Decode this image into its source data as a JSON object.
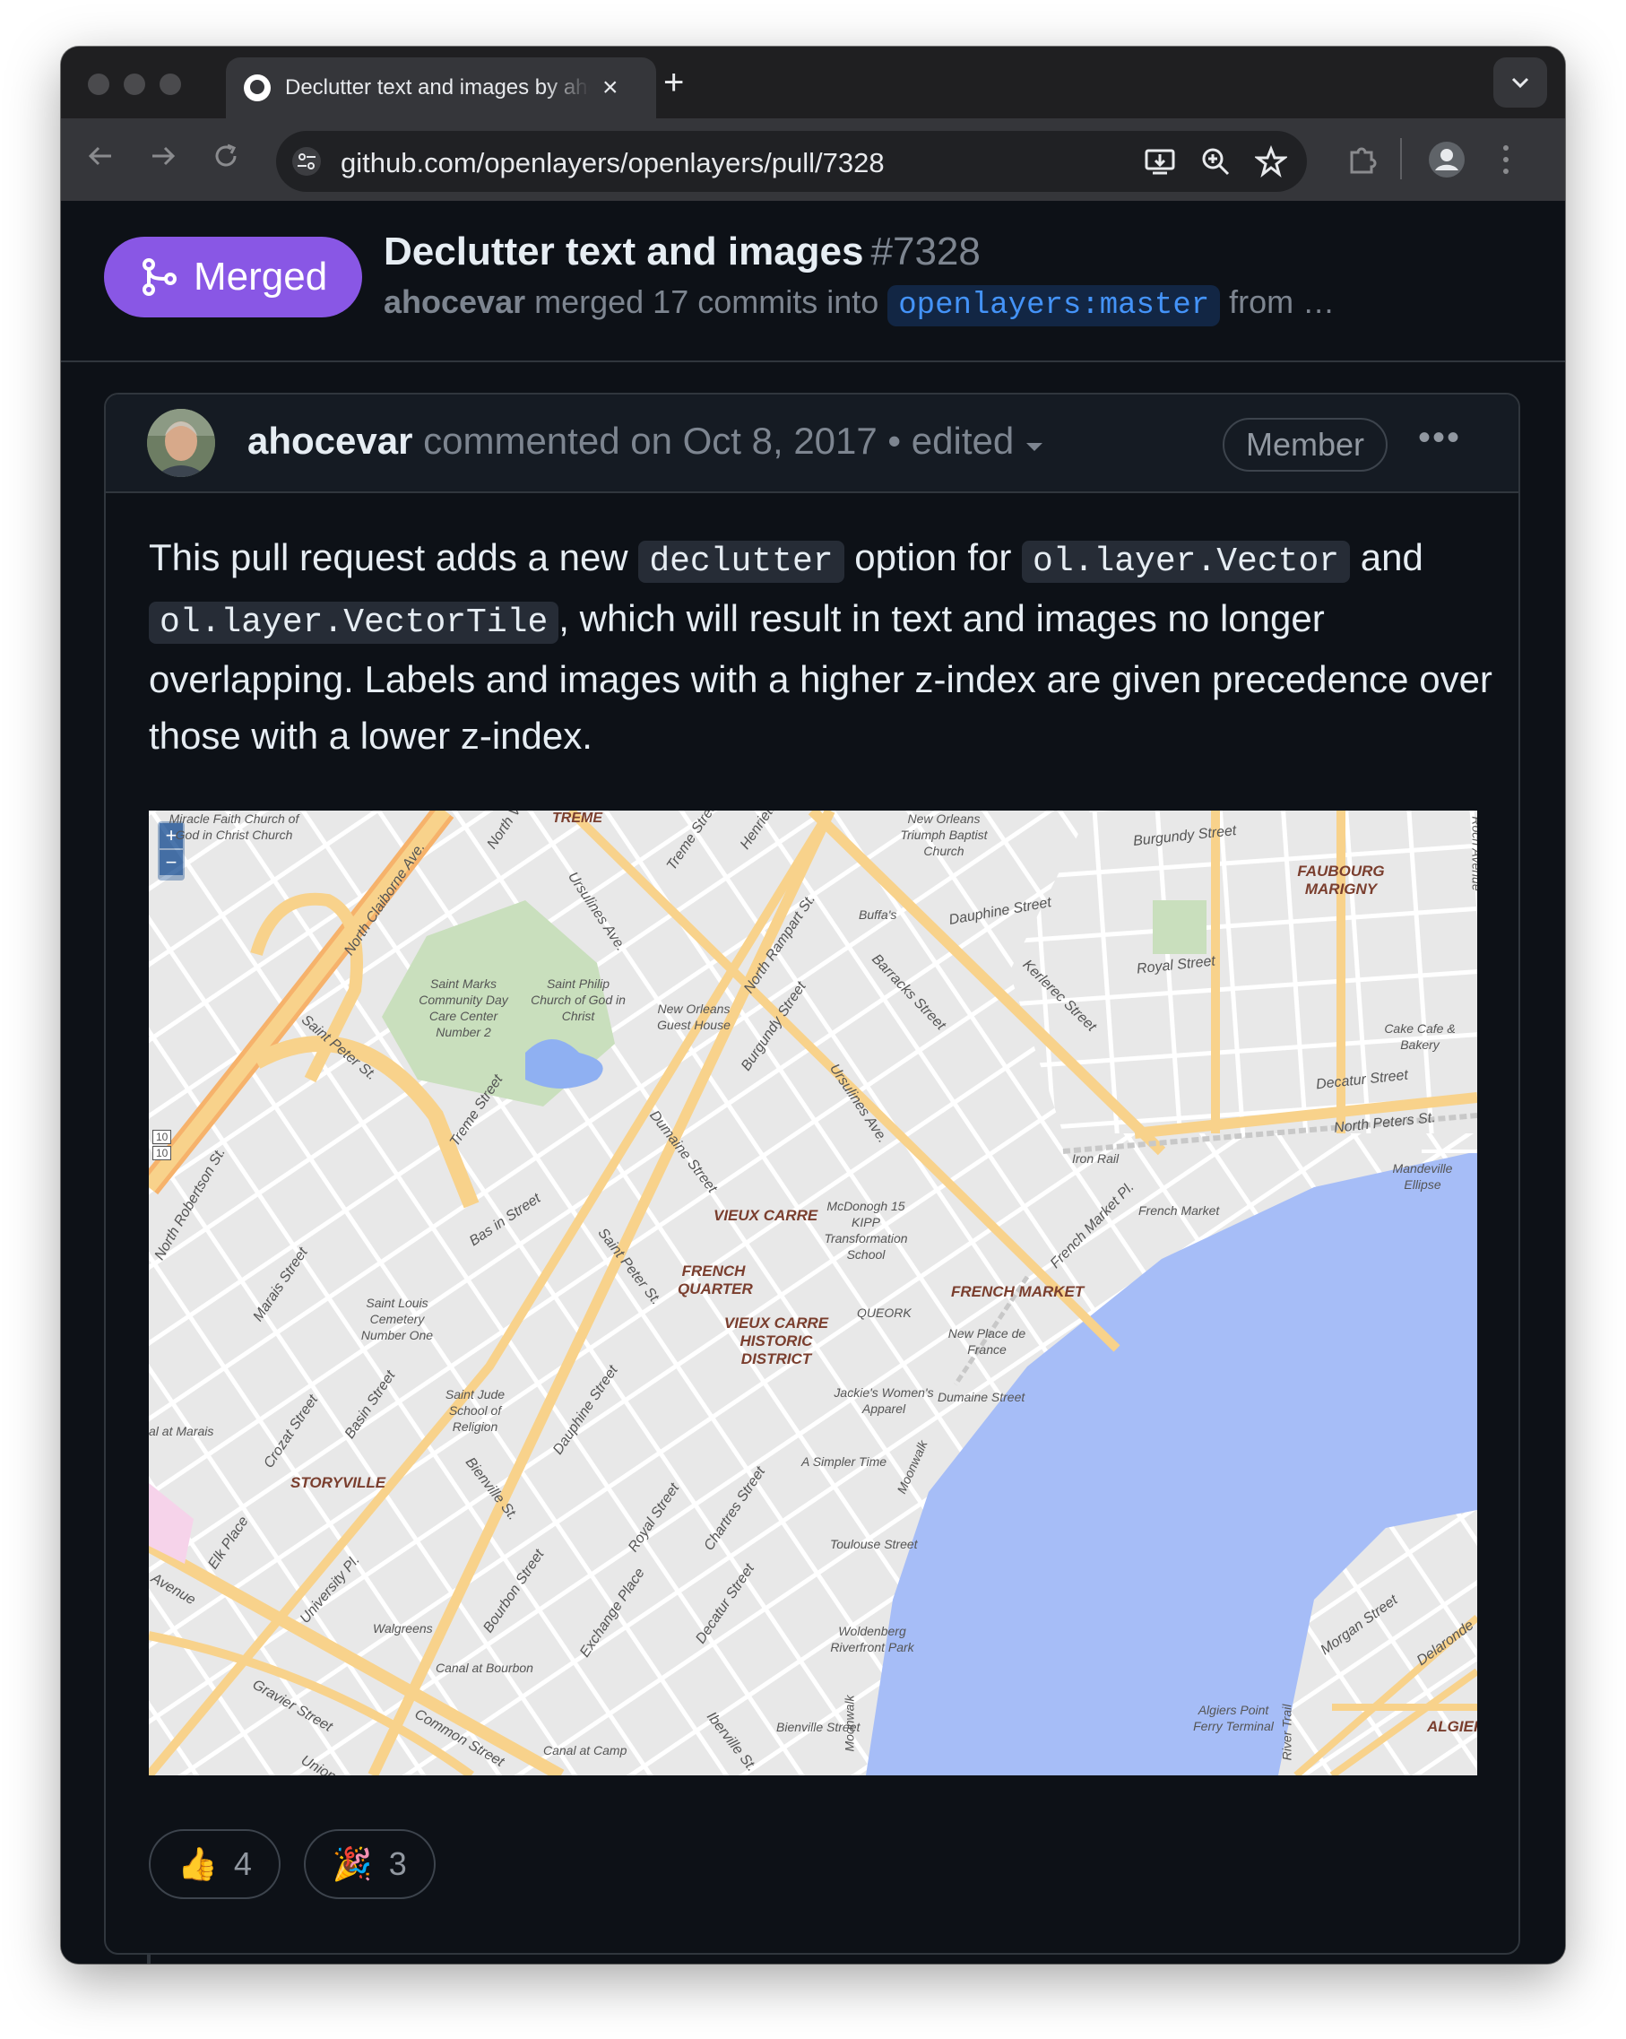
{
  "browser": {
    "tab_title": "Declutter text and images by ahocevar",
    "tab_close": "×",
    "new_tab": "+",
    "url": "github.com/openlayers/openlayers/pull/7328"
  },
  "pr": {
    "status": "Merged",
    "title": "Declutter text and images",
    "number": "#7328",
    "author": "ahocevar",
    "merge_text": " merged 17 commits into ",
    "base_branch": "openlayers:master",
    "from_text": " from …"
  },
  "comment": {
    "author": "ahocevar",
    "action": " commented on Oct 8, 2017 • edited ",
    "role": "Member",
    "more": "•••",
    "body": {
      "t1": "This pull request adds a new ",
      "c1": "declutter",
      "t2": " option for ",
      "c2": "ol.layer.Vector",
      "t3": " and ",
      "c3": "ol.layer.VectorTile",
      "t4": ", which will result in text and images no longer overlapping. Labels and images with a higher z-index are given precedence over those with a lower z-index."
    },
    "reactions": [
      {
        "emoji": "👍",
        "count": "4"
      },
      {
        "emoji": "🎉",
        "count": "3"
      }
    ]
  },
  "map": {
    "zoom_in": "+",
    "zoom_out": "−",
    "districts": {
      "treme": "TREME",
      "vieux_carre": "VIEUX CARRE",
      "french_quarter": "FRENCH QUARTER",
      "vieux_carre_historic": "VIEUX CARRE HISTORIC DISTRICT",
      "french_market": "FRENCH MARKET",
      "storyville": "STORYVILLE",
      "faubourg_marigny": "FAUBOURG MARIGNY",
      "algiers": "ALGIER"
    },
    "streets": {
      "north_claiborne": "North Claiborne Ave.",
      "saint_peter_1": "Saint Peter St.",
      "ursulines_1": "Ursulines Ave.",
      "north_rampart": "North Rampart St.",
      "barracks": "Barracks Street",
      "dauphine_st": "Dauphine Street",
      "burgundy_top": "Burgundy Street",
      "royal_top": "Royal Street",
      "kerlerec": "Kerlerec Street",
      "decatur_top": "Decatur Street",
      "north_peters": "North Peters St.",
      "burgundy_mid": "Burgundy Street",
      "ursulines_2": "Ursulines Ave.",
      "dumaine": "Dumaine Street",
      "treme_street": "Treme Street",
      "basin_street_1": "Bas in Street",
      "saint_peter_2": "Saint Peter St.",
      "french_market_pl": "French Market Pl.",
      "marais": "Marais Street",
      "basin_street_2": "Basin Street",
      "crozat": "Crozat Street",
      "dauphine_2": "Dauphine Street",
      "bienville": "Bienville St.",
      "royal_2": "Royal Street",
      "chartres": "Chartres Street",
      "decatur_2": "Decatur Street",
      "bourbon": "Bourbon Street",
      "exchange": "Exchange Place",
      "university": "University Pl.",
      "elk": "Elk Place",
      "gravier": "Gravier Street",
      "common": "Common Street",
      "iberville": "Iberville St.",
      "toulouse": "Toulouse Street",
      "dumaine_2": "Dumaine Street",
      "moonwalk_1": "Moonwalk",
      "moonwalk_2": "Moonwalk",
      "bienville_2": "Bienville Street",
      "morgan": "Morgan Street",
      "delaronde": "Delaronde",
      "robertson": "North Robertson St.",
      "treme_top": "Treme Street",
      "henriette": "Henriette",
      "north_top": "North V",
      "avenue": "Avenue",
      "roch": "Roch Avenue",
      "river_trail": "River Trail",
      "union": "Union"
    },
    "pois": {
      "miracle": "Miracle Faith Church of God in Christ Church",
      "triumph": "New Orleans Triumph Baptist Church",
      "buffas": "Buffa's",
      "saint_marks": "Saint Marks Community Day Care Center Number 2",
      "saint_philip": "Saint Philip Church of God in Christ",
      "guest_house": "New Orleans Guest House",
      "cake_cafe": "Cake Cafe & Bakery",
      "mandeville": "Mandeville Ellipse",
      "iron_rail": "Iron Rail",
      "french_market_poi": "French Market",
      "mcdonogh": "McDonogh 15 KIPP Transformation School",
      "queork": "QUEORK",
      "new_place": "New Place de France",
      "saint_louis": "Saint Louis Cemetery Number One",
      "saint_jude": "Saint Jude School of Religion",
      "jackies": "Jackie's Women's Apparel",
      "simpler_time": "A Simpler Time",
      "walgreens": "Walgreens",
      "canal_bourbon": "Canal at Bourbon",
      "canal_camp": "Canal at Camp",
      "woldenberg": "Woldenberg Riverfront Park",
      "algiers_point": "Algiers Point Ferry Terminal",
      "canal_marais": "al at Marais",
      "route_10a": "10",
      "route_10b": "10"
    }
  },
  "colors": {
    "merged_purple": "#8957e5",
    "link_blue": "#4493f8",
    "bg": "#0d1117",
    "border": "#30363d",
    "water": "#a6bdf7",
    "park": "#c9dfbd",
    "major_road": "#f8d28b"
  }
}
